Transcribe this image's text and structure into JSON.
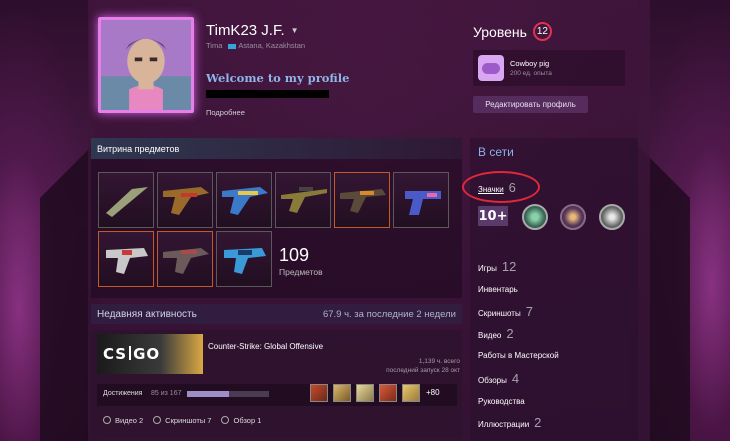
{
  "profile": {
    "persona_name": "TimK23 J.F.",
    "real_name": "Tima",
    "location": "Astana, Kazakhstan",
    "summary_title": "Welcome to my profile",
    "more_link": "Подробнее"
  },
  "level": {
    "label": "Уровень",
    "value": "12"
  },
  "favorite_badge": {
    "name": "Cowboy pig",
    "xp": "200 ед. опыта"
  },
  "edit_profile_label": "Редактировать профиль",
  "showcase": {
    "title": "Витрина предметов",
    "count": "109",
    "count_label": "Предметов"
  },
  "activity": {
    "title": "Недавняя активность",
    "hours_summary": "67.9 ч. за последние 2 недели",
    "game": {
      "name": "Counter-Strike: Global Offensive",
      "logo_left": "CS",
      "logo_right": "GO",
      "hours_total": "1,139 ч. всего",
      "last_played": "последний запуск 28 окт"
    },
    "achievements": {
      "label": "Достижения",
      "count": "85 из 167",
      "progress": 0.51,
      "more": "+80"
    },
    "stats": {
      "videos": "Видео 2",
      "screenshots": "Скриншоты 7",
      "reviews": "Обзор 1"
    }
  },
  "sidebar": {
    "status": "В сети",
    "badges": {
      "label": "Значки",
      "count": "6"
    },
    "badge_level_text": "10+",
    "items": [
      {
        "label": "Игры",
        "count": "12"
      },
      {
        "label": "Инвентарь",
        "count": ""
      },
      {
        "label": "Скриншоты",
        "count": "7"
      },
      {
        "label": "Видео",
        "count": "2"
      },
      {
        "label": "Работы в Мастерской",
        "count": ""
      },
      {
        "label": "Обзоры",
        "count": "4"
      },
      {
        "label": "Руководства",
        "count": ""
      },
      {
        "label": "Иллюстрации",
        "count": "2"
      }
    ]
  },
  "colors": {
    "accent": "#e67fe8",
    "highlight_ring": "#e0283a",
    "link_blue": "#8ab2e8"
  }
}
